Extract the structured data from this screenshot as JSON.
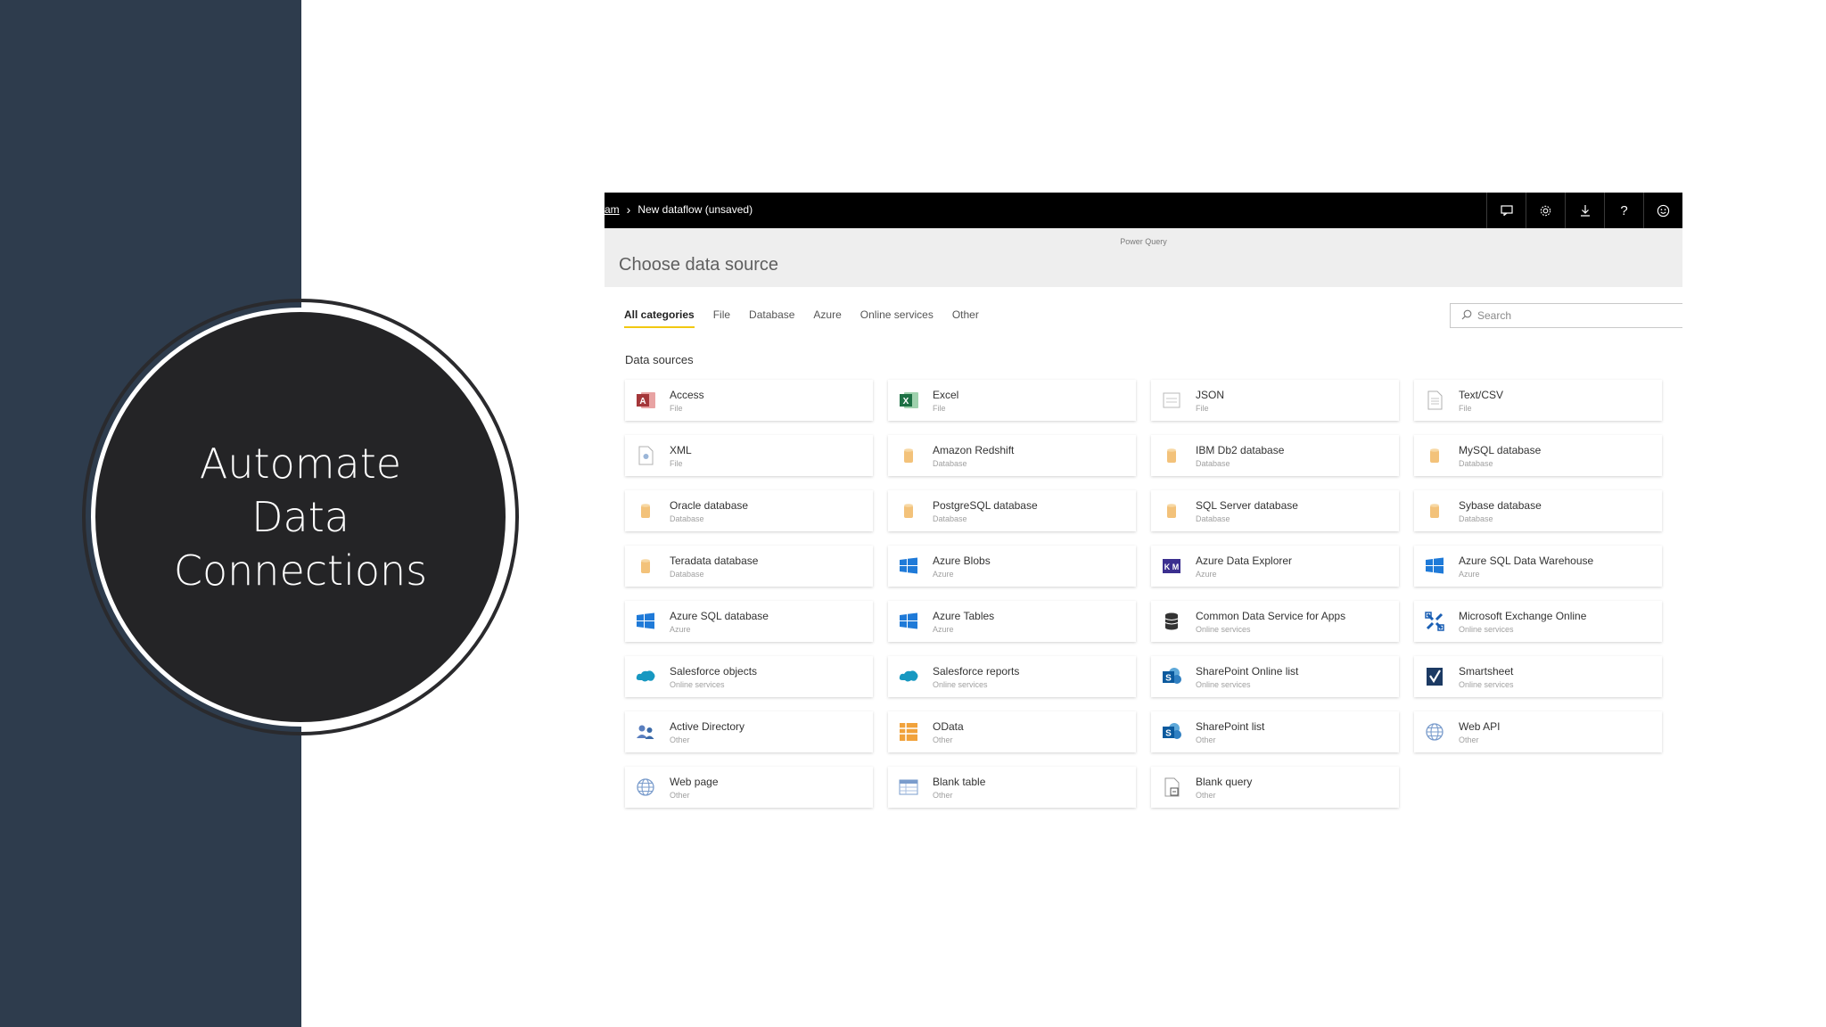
{
  "slide": {
    "title": "Automate Data Connections"
  },
  "app": {
    "breadcrumb": {
      "root": "am",
      "current": "New dataflow (unsaved)"
    },
    "top_icons": [
      "feedback-icon",
      "gear-icon",
      "download-icon",
      "help-icon",
      "smiley-icon"
    ],
    "product_label": "Power Query",
    "page_title": "Choose data source",
    "tabs": [
      "All categories",
      "File",
      "Database",
      "Azure",
      "Online services",
      "Other"
    ],
    "active_tab": "All categories",
    "search": {
      "placeholder": "Search",
      "value": ""
    },
    "section_title": "Data sources",
    "sources": [
      {
        "name": "Access",
        "category": "File",
        "icon": "access-icon"
      },
      {
        "name": "Excel",
        "category": "File",
        "icon": "excel-icon"
      },
      {
        "name": "JSON",
        "category": "File",
        "icon": "json-icon"
      },
      {
        "name": "Text/CSV",
        "category": "File",
        "icon": "text-csv-icon"
      },
      {
        "name": "XML",
        "category": "File",
        "icon": "xml-icon"
      },
      {
        "name": "Amazon Redshift",
        "category": "Database",
        "icon": "database-icon"
      },
      {
        "name": "IBM Db2 database",
        "category": "Database",
        "icon": "database-icon"
      },
      {
        "name": "MySQL database",
        "category": "Database",
        "icon": "database-icon"
      },
      {
        "name": "Oracle database",
        "category": "Database",
        "icon": "database-icon"
      },
      {
        "name": "PostgreSQL database",
        "category": "Database",
        "icon": "database-icon"
      },
      {
        "name": "SQL Server database",
        "category": "Database",
        "icon": "database-icon"
      },
      {
        "name": "Sybase database",
        "category": "Database",
        "icon": "database-icon"
      },
      {
        "name": "Teradata database",
        "category": "Database",
        "icon": "database-icon"
      },
      {
        "name": "Azure Blobs",
        "category": "Azure",
        "icon": "windows-icon"
      },
      {
        "name": "Azure Data Explorer",
        "category": "Azure",
        "icon": "data-explorer-icon"
      },
      {
        "name": "Azure SQL Data Warehouse",
        "category": "Azure",
        "icon": "windows-icon"
      },
      {
        "name": "Azure SQL database",
        "category": "Azure",
        "icon": "windows-icon"
      },
      {
        "name": "Azure Tables",
        "category": "Azure",
        "icon": "windows-icon"
      },
      {
        "name": "Common Data Service for Apps",
        "category": "Online services",
        "icon": "cds-icon"
      },
      {
        "name": "Microsoft Exchange Online",
        "category": "Online services",
        "icon": "exchange-icon"
      },
      {
        "name": "Salesforce objects",
        "category": "Online services",
        "icon": "salesforce-icon"
      },
      {
        "name": "Salesforce reports",
        "category": "Online services",
        "icon": "salesforce-icon"
      },
      {
        "name": "SharePoint Online list",
        "category": "Online services",
        "icon": "sharepoint-icon"
      },
      {
        "name": "Smartsheet",
        "category": "Online services",
        "icon": "smartsheet-icon"
      },
      {
        "name": "Active Directory",
        "category": "Other",
        "icon": "active-directory-icon"
      },
      {
        "name": "OData",
        "category": "Other",
        "icon": "odata-icon"
      },
      {
        "name": "SharePoint list",
        "category": "Other",
        "icon": "sharepoint-icon"
      },
      {
        "name": "Web API",
        "category": "Other",
        "icon": "globe-icon"
      },
      {
        "name": "Web page",
        "category": "Other",
        "icon": "globe-icon"
      },
      {
        "name": "Blank table",
        "category": "Other",
        "icon": "table-icon"
      },
      {
        "name": "Blank query",
        "category": "Other",
        "icon": "blank-query-icon"
      }
    ]
  },
  "colors": {
    "side_panel": "#2e3c4d",
    "circle": "#242426",
    "active_tab_underline": "#f2c811",
    "top_bar": "#000000"
  }
}
